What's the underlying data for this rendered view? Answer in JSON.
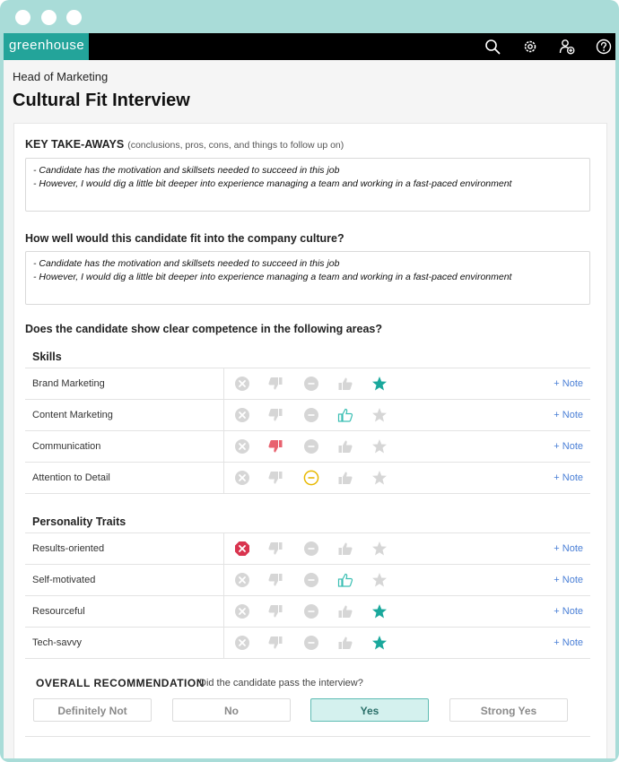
{
  "app": {
    "logo_text": "greenhouse"
  },
  "toolbar": {
    "icons": [
      "search-icon",
      "gear-icon",
      "add-user-icon",
      "help-icon"
    ]
  },
  "header": {
    "job_title": "Head of Marketing",
    "page_title": "Cultural Fit Interview"
  },
  "takeaways": {
    "label": "KEY TAKE-AWAYS",
    "hint": "(conclusions, pros, cons, and things to follow up on)",
    "lines": [
      "- Candidate has the motivation and skillsets needed to succeed in this job",
      "- However, I would dig a little bit deeper into experience managing a team and working in a fast-paced environment"
    ]
  },
  "culture_fit": {
    "label": "How well would this candidate fit into the company culture?",
    "lines": [
      "- Candidate has the motivation and skillsets needed to succeed in this job",
      "- However, I would dig a little bit deeper into experience managing a team and working in a fast-paced environment"
    ]
  },
  "competence": {
    "label": "Does the candidate show clear competence in the following areas?",
    "note_label": "+ Note",
    "rating_scale": [
      "definitely-not",
      "no",
      "mixed",
      "yes",
      "strong-yes"
    ],
    "sections": [
      {
        "title": "Skills",
        "rows": [
          {
            "label": "Brand Marketing",
            "rating": "strong-yes"
          },
          {
            "label": "Content Marketing",
            "rating": "yes"
          },
          {
            "label": "Communication",
            "rating": "no"
          },
          {
            "label": "Attention to Detail",
            "rating": "mixed"
          }
        ]
      },
      {
        "title": "Personality Traits",
        "rows": [
          {
            "label": "Results-oriented",
            "rating": "definitely-not"
          },
          {
            "label": "Self-motivated",
            "rating": "yes"
          },
          {
            "label": "Resourceful",
            "rating": "strong-yes"
          },
          {
            "label": "Tech-savvy",
            "rating": "strong-yes"
          }
        ]
      }
    ]
  },
  "overall": {
    "label": "OVERALL RECOMMENDATION",
    "question": "Did the candidate pass the interview?",
    "options": [
      "Definitely Not",
      "No",
      "Yes",
      "Strong Yes"
    ],
    "selected": "Yes"
  },
  "colors": {
    "brand": "#23a49a",
    "frame": "#a9dcd8",
    "inactive_icon": "#d6d6d6",
    "definitely_not": "#d9344f",
    "no": "#e8626f",
    "mixed": "#e8b800",
    "yes": "#3bbfb3",
    "strong_yes": "#1aa89c",
    "link": "#4a7fd6"
  }
}
